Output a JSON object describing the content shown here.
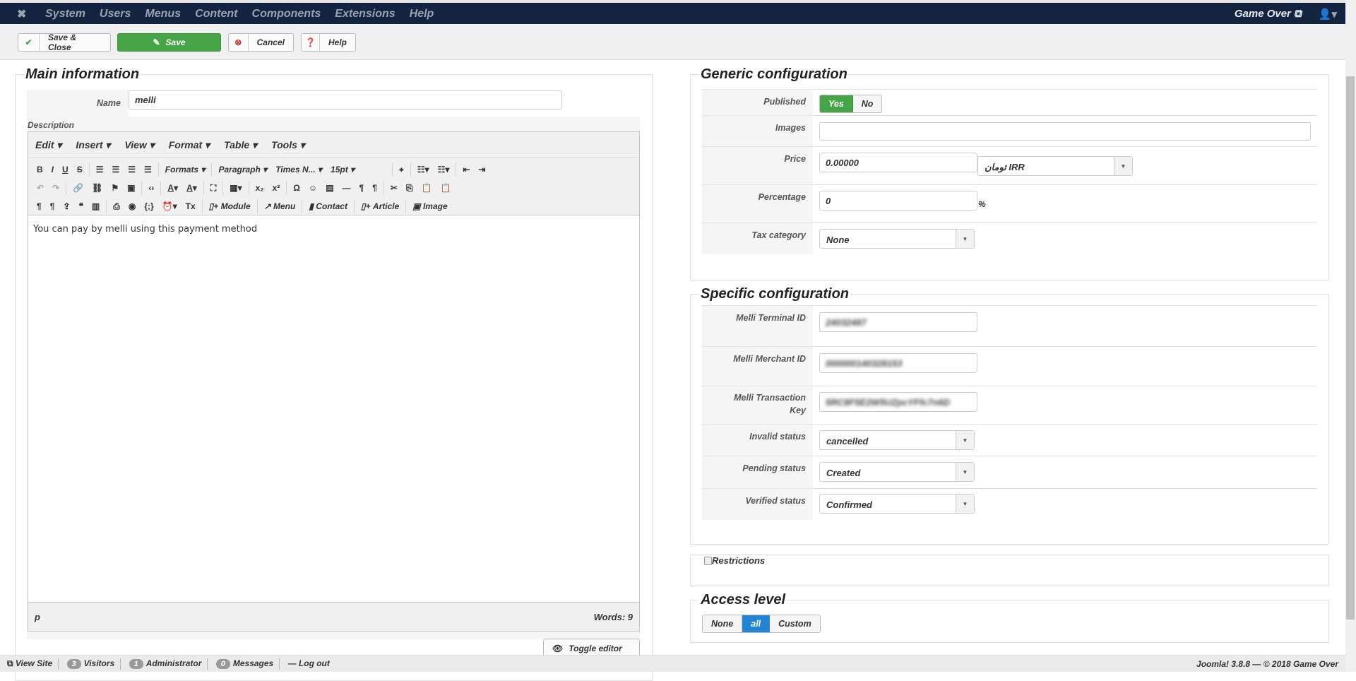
{
  "navbar": {
    "menu": [
      "System",
      "Users",
      "Menus",
      "Content",
      "Components",
      "Extensions",
      "Help"
    ],
    "site_link": "Game Over ⧉",
    "user_icon": "user-icon"
  },
  "toolbar": {
    "save_close": "Save & Close",
    "save": "Save",
    "cancel": "Cancel",
    "help": "Help"
  },
  "main": {
    "legend": "Main information",
    "name_label": "Name",
    "name_value": "melli",
    "description_label": "Description",
    "editor": {
      "menu": [
        "Edit ▾",
        "Insert ▾",
        "View ▾",
        "Format ▾",
        "Table ▾",
        "Tools ▾"
      ],
      "formats": "Formats ▾",
      "paragraph": "Paragraph ▾",
      "font": "Times N... ▾",
      "size": "15pt ▾",
      "module": "Module",
      "menu_btn": "Menu",
      "contact": "Contact",
      "article": "Article",
      "image": "Image",
      "content": "You can pay by melli using this payment method",
      "path": "p",
      "words": "Words: 9"
    },
    "toggle_editor": "Toggle editor"
  },
  "generic": {
    "legend": "Generic configuration",
    "published_label": "Published",
    "yes": "Yes",
    "no": "No",
    "images_label": "Images",
    "images_value": "",
    "price_label": "Price",
    "price_value": "0.00000",
    "currency": "تومان IRR",
    "percentage_label": "Percentage",
    "percentage_value": "0",
    "percent_sign": "%",
    "tax_label": "Tax category",
    "tax_value": "None"
  },
  "specific": {
    "legend": "Specific configuration",
    "terminal_label": "Melli Terminal ID",
    "terminal_value": "24032487",
    "merchant_label": "Melli Merchant ID",
    "merchant_value": "000000140328153",
    "key_label": "Melli Transaction Key",
    "key_value": "5RC8F5E2W5UZpcYFfc7n6D",
    "invalid_label": "Invalid status",
    "invalid_value": "cancelled",
    "pending_label": "Pending status",
    "pending_value": "Created",
    "verified_label": "Verified status",
    "verified_value": "Confirmed"
  },
  "restrictions": {
    "label": "Restrictions"
  },
  "access": {
    "legend": "Access level",
    "options": [
      "None",
      "all",
      "Custom"
    ],
    "selected": "all"
  },
  "footer": {
    "view_site": "View Site",
    "visitors_count": "3",
    "visitors": "Visitors",
    "admin_count": "1",
    "admin": "Administrator",
    "messages_count": "0",
    "messages": "Messages",
    "logout": "Log out",
    "version": "Joomla! 3.8.8  —  © 2018 Game Over"
  }
}
